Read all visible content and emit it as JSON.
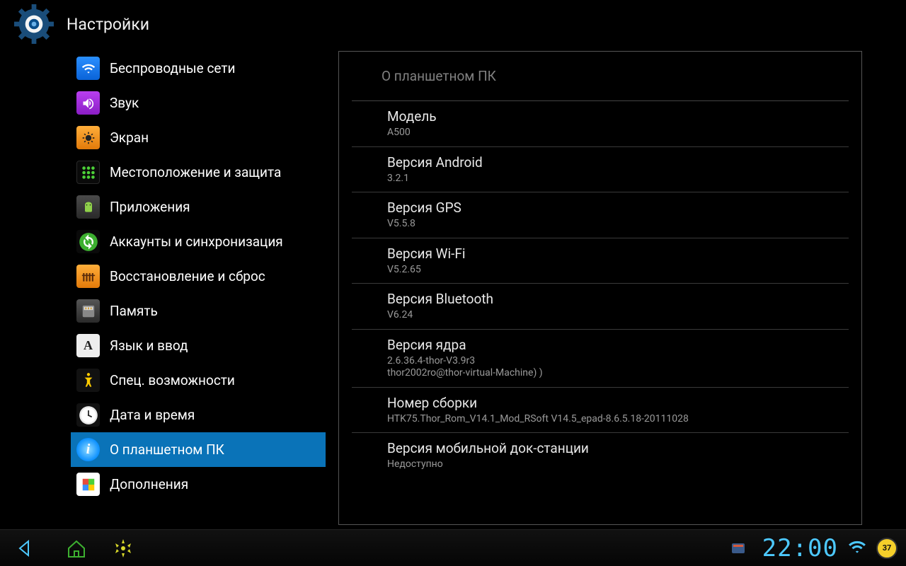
{
  "header": {
    "title": "Настройки"
  },
  "sidebar": {
    "items": [
      {
        "label": "Беспроводные сети",
        "icon": "wifi"
      },
      {
        "label": "Звук",
        "icon": "sound"
      },
      {
        "label": "Экран",
        "icon": "screen"
      },
      {
        "label": "Местоположение и защита",
        "icon": "location"
      },
      {
        "label": "Приложения",
        "icon": "apps"
      },
      {
        "label": "Аккаунты и синхронизация",
        "icon": "sync"
      },
      {
        "label": "Восстановление и сброс",
        "icon": "backup"
      },
      {
        "label": "Память",
        "icon": "storage"
      },
      {
        "label": "Язык и ввод",
        "icon": "lang"
      },
      {
        "label": "Спец. возможности",
        "icon": "access"
      },
      {
        "label": "Дата и время",
        "icon": "date"
      },
      {
        "label": "О планшетном ПК",
        "icon": "about"
      },
      {
        "label": "Дополнения",
        "icon": "addons"
      }
    ]
  },
  "panel": {
    "title": "О планшетном ПК",
    "rows": [
      {
        "label": "Модель",
        "value": "A500"
      },
      {
        "label": "Версия Android",
        "value": "3.2.1"
      },
      {
        "label": "Версия GPS",
        "value": "V5.5.8"
      },
      {
        "label": "Версия Wi-Fi",
        "value": "V5.2.65"
      },
      {
        "label": "Версия Bluetooth",
        "value": "V6.24"
      },
      {
        "label": "Версия ядра",
        "value": "2.6.36.4-thor-V3.9r3\nthor2002ro@thor-virtual-Machine) )"
      },
      {
        "label": "Номер сборки",
        "value": "HTK75.Thor_Rom_V14.1_Mod_RSoft V14.5_epad-8.6.5.18-20111028"
      },
      {
        "label": "Версия мобильной док-станции",
        "value": "Недоступно"
      }
    ]
  },
  "navbar": {
    "clock": "22:00",
    "battery": "37"
  }
}
